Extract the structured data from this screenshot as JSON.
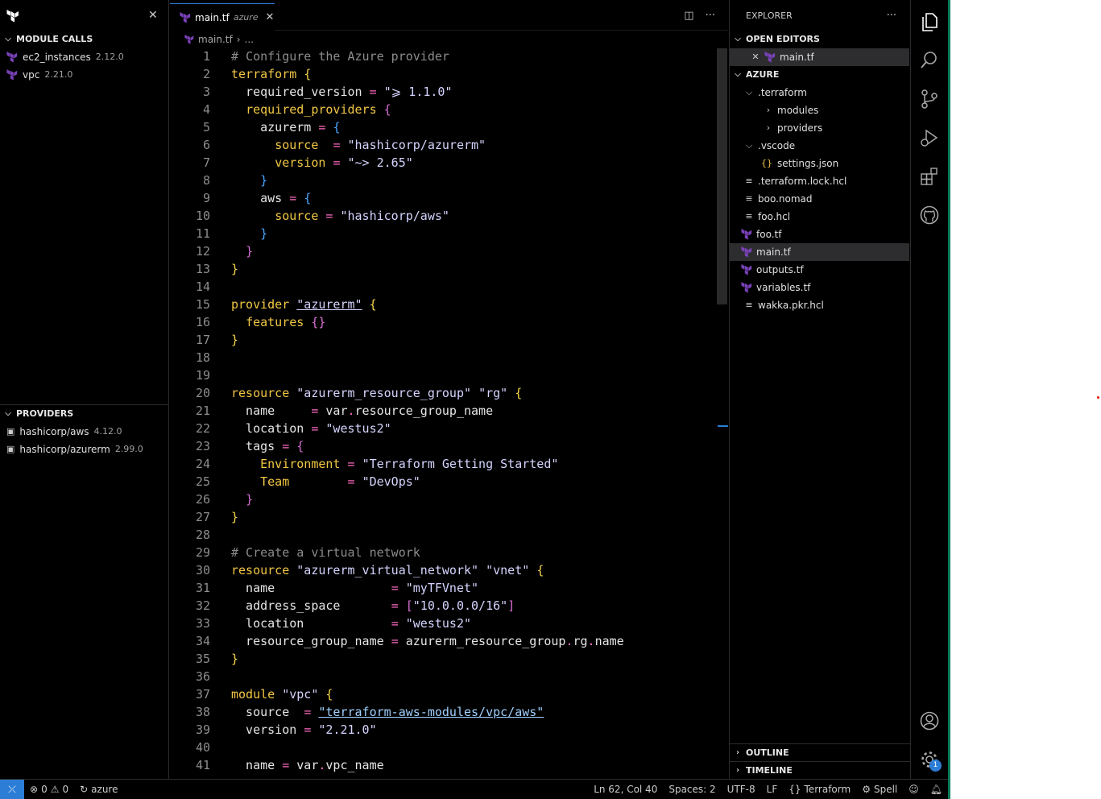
{
  "left_panel": {
    "module_calls_title": "MODULE CALLS",
    "modules": [
      {
        "name": "ec2_instances",
        "version": "2.12.0"
      },
      {
        "name": "vpc",
        "version": "2.21.0"
      }
    ],
    "providers_title": "PROVIDERS",
    "providers": [
      {
        "name": "hashicorp/aws",
        "version": "4.12.0"
      },
      {
        "name": "hashicorp/azurerm",
        "version": "2.99.0"
      }
    ]
  },
  "editor": {
    "tab_name": "main.tf",
    "tab_description": "azure",
    "breadcrumb_file": "main.tf",
    "breadcrumb_more": "...",
    "line_numbers": [
      "1",
      "2",
      "3",
      "4",
      "5",
      "6",
      "7",
      "8",
      "9",
      "10",
      "11",
      "12",
      "13",
      "14",
      "15",
      "16",
      "17",
      "18",
      "19",
      "20",
      "21",
      "22",
      "23",
      "24",
      "25",
      "26",
      "27",
      "28",
      "29",
      "30",
      "31",
      "32",
      "33",
      "34",
      "35",
      "36",
      "37",
      "38",
      "39",
      "40",
      "41"
    ]
  },
  "explorer": {
    "title": "EXPLORER",
    "open_editors_title": "OPEN EDITORS",
    "open_editor_file": "main.tf",
    "workspace_title": "AZURE",
    "tree": [
      {
        "label": ".terraform",
        "kind": "folder-open",
        "depth": 1
      },
      {
        "label": "modules",
        "kind": "folder",
        "depth": 2
      },
      {
        "label": "providers",
        "kind": "folder",
        "depth": 2
      },
      {
        "label": ".vscode",
        "kind": "folder-open",
        "depth": 1
      },
      {
        "label": "settings.json",
        "kind": "json",
        "depth": 2
      },
      {
        "label": ".terraform.lock.hcl",
        "kind": "text",
        "depth": 1
      },
      {
        "label": "boo.nomad",
        "kind": "text",
        "depth": 1
      },
      {
        "label": "foo.hcl",
        "kind": "text",
        "depth": 1
      },
      {
        "label": "foo.tf",
        "kind": "terraform",
        "depth": 1
      },
      {
        "label": "main.tf",
        "kind": "terraform",
        "depth": 1
      },
      {
        "label": "outputs.tf",
        "kind": "terraform",
        "depth": 1
      },
      {
        "label": "variables.tf",
        "kind": "terraform",
        "depth": 1
      },
      {
        "label": "wakka.pkr.hcl",
        "kind": "text",
        "depth": 1
      }
    ],
    "outline_title": "OUTLINE",
    "timeline_title": "TIMELINE"
  },
  "activity": {
    "settings_badge": "1"
  },
  "status_bar": {
    "errors": "0",
    "warnings": "0",
    "sync_label": "azure",
    "cursor": "Ln 62, Col 40",
    "spaces": "Spaces: 2",
    "encoding": "UTF-8",
    "eol": "LF",
    "language": "Terraform",
    "spell": "Spell"
  },
  "colors": {
    "accent": "#2b7dd6",
    "keyword": "#f2c744",
    "terraform_purple": "#7b42bc"
  }
}
